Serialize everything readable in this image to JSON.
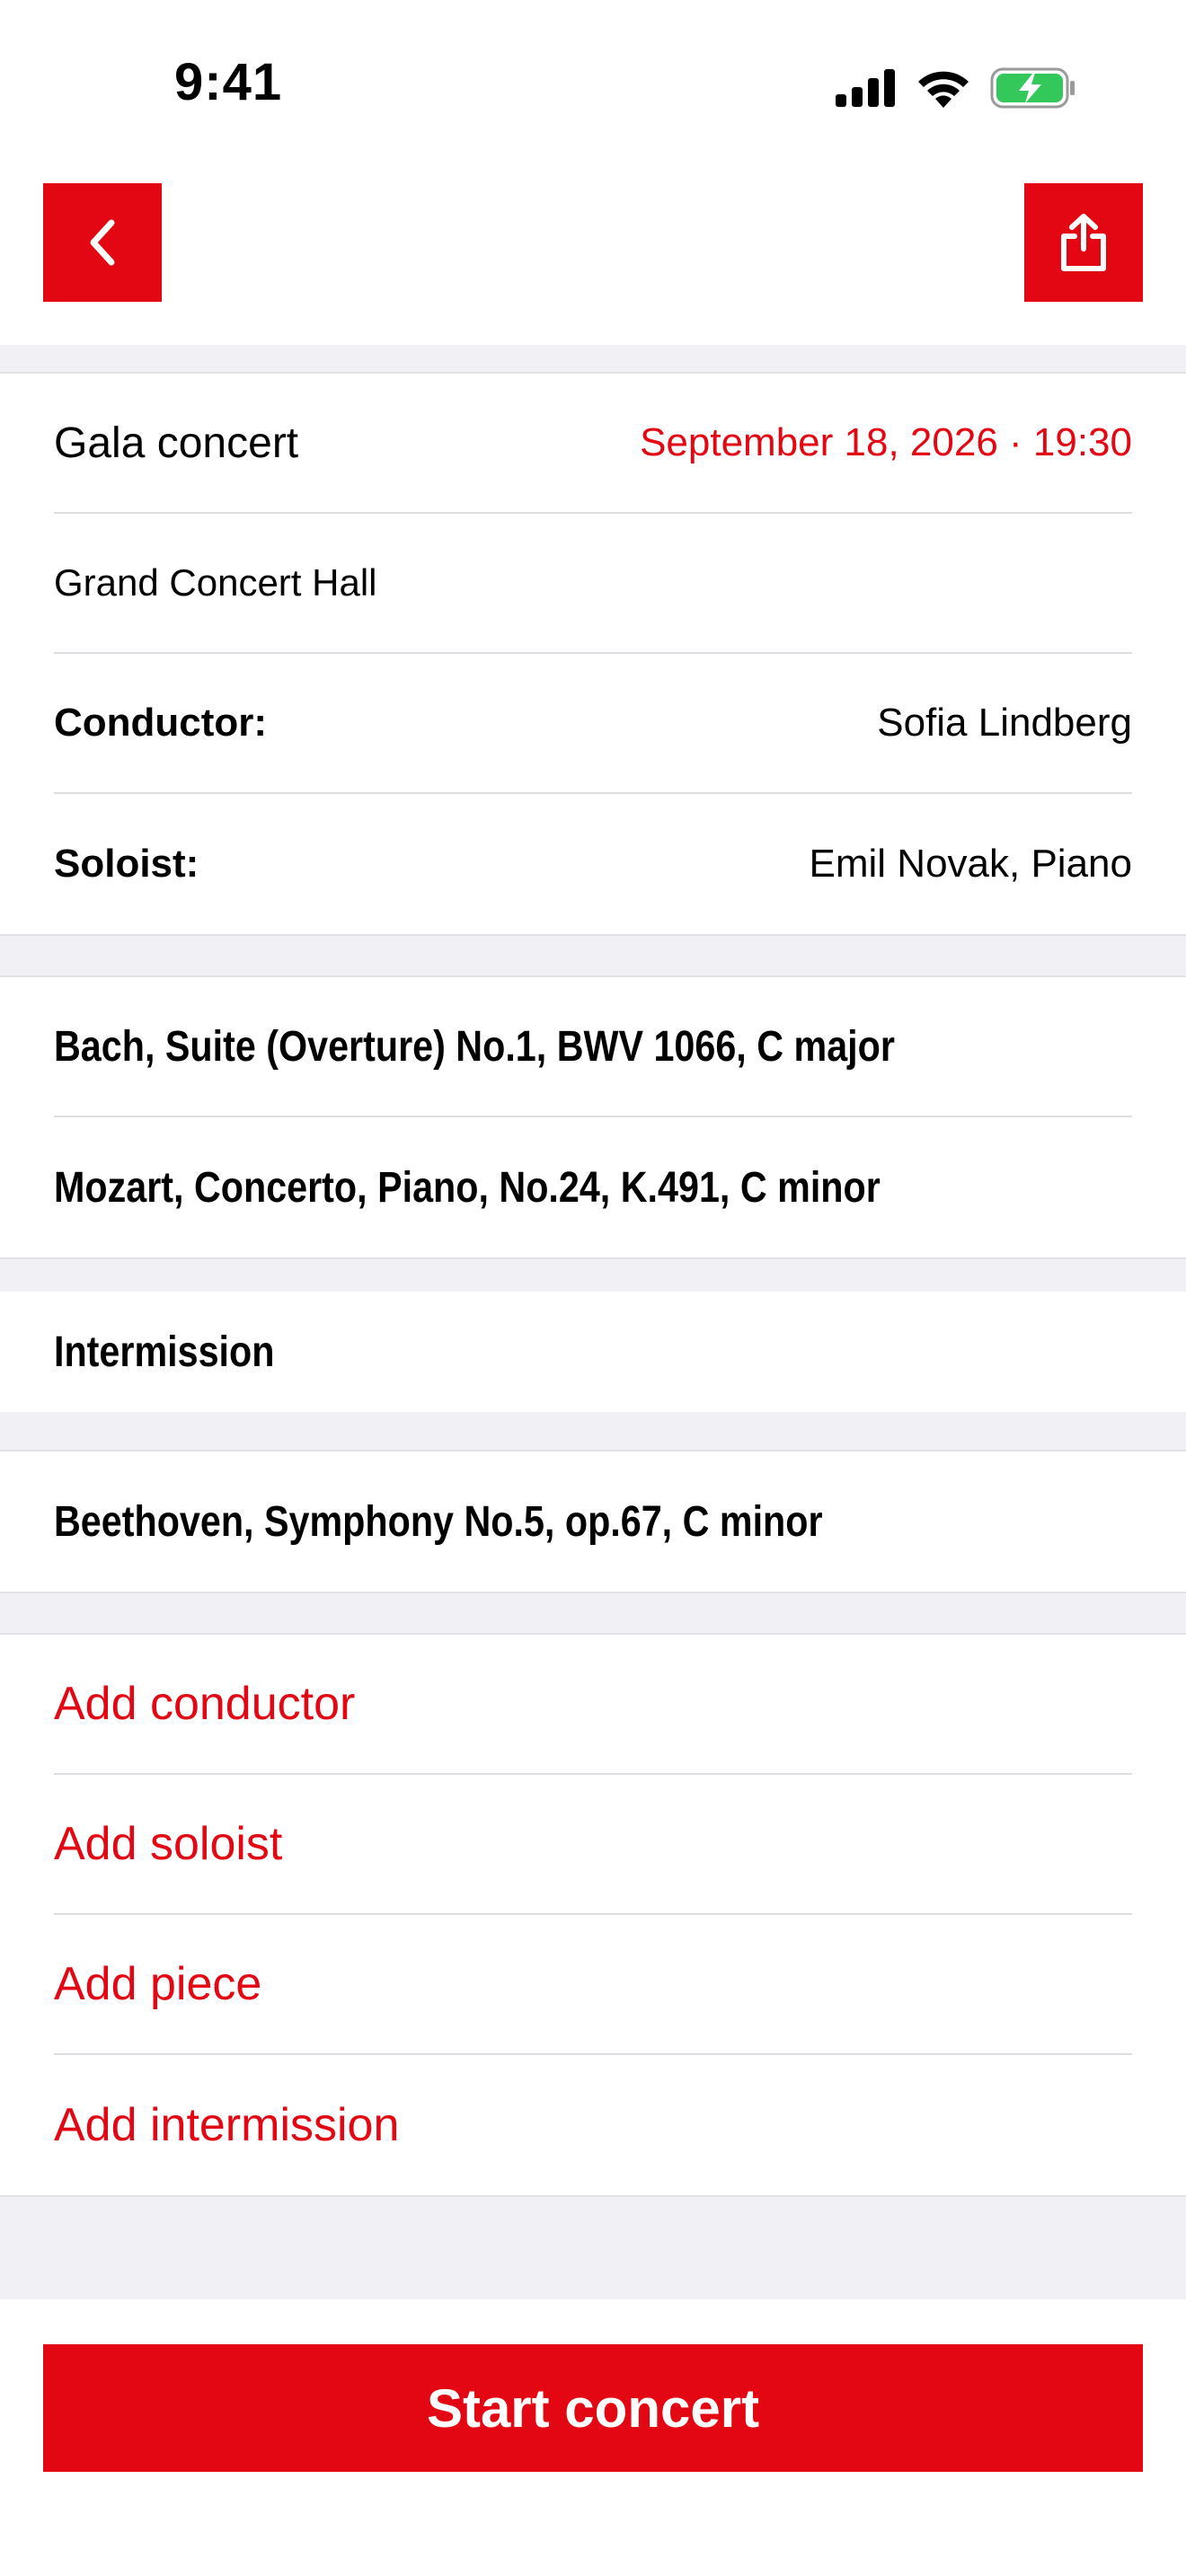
{
  "status_bar": {
    "time": "9:41"
  },
  "nav": {
    "back_icon": "chevron-left-icon",
    "share_icon": "share-icon"
  },
  "concert": {
    "title": "Gala concert",
    "datetime": "September 18, 2026 · 19:30",
    "venue": "Grand Concert Hall",
    "conductor_label": "Conductor:",
    "conductor_value": "Sofia Lindberg",
    "soloist_label": "Soloist:",
    "soloist_value": "Emil Novak, Piano"
  },
  "program": {
    "part1": [
      "Bach, Suite (Overture) No.1, BWV 1066, C major",
      "Mozart, Concerto, Piano, No.24, K.491, C minor"
    ],
    "intermission": "Intermission",
    "part2": [
      "Beethoven, Symphony No.5, op.67, C minor"
    ]
  },
  "actions": {
    "add_conductor": "Add conductor",
    "add_soloist": "Add soloist",
    "add_piece": "Add piece",
    "add_intermission": "Add intermission"
  },
  "start_button": "Start concert",
  "colors": {
    "accent": "#e30613",
    "background": "#f1f1f5",
    "battery": "#34c759"
  }
}
